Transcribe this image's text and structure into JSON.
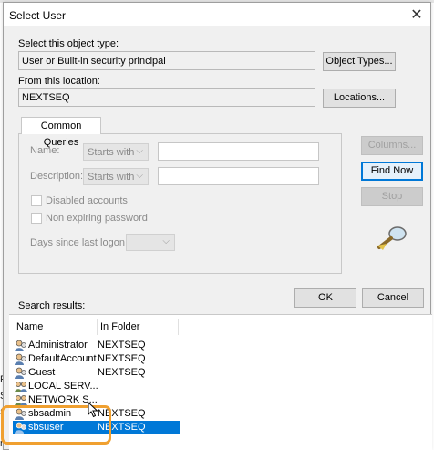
{
  "background": {
    "fragments": [
      "P.",
      "Se",
      "Se",
      "n"
    ]
  },
  "dialog": {
    "title": "Select User",
    "close_glyph": "✕",
    "object_type": {
      "label": "Select this object type:",
      "value": "User or Built-in security principal",
      "button": "Object Types..."
    },
    "location": {
      "label": "From this location:",
      "value": "NEXTSEQ",
      "button": "Locations..."
    },
    "common_queries": {
      "tab_label": "Common Queries",
      "name_label": "Name:",
      "name_mode": "Starts with",
      "description_label": "Description:",
      "description_mode": "Starts with",
      "disabled_accounts": "Disabled accounts",
      "non_expiring_password": "Non expiring password",
      "days_since_logon_label": "Days since last logon:"
    },
    "side_buttons": {
      "columns": "Columns...",
      "find_now": "Find Now",
      "stop": "Stop"
    },
    "ok": "OK",
    "cancel": "Cancel",
    "search_results_label": "Search results:",
    "results": {
      "columns": [
        "Name",
        "In Folder"
      ],
      "rows": [
        {
          "name": "Administrator",
          "folder": "NEXTSEQ",
          "icon": "user-icon"
        },
        {
          "name": "DefaultAccount",
          "folder": "NEXTSEQ",
          "icon": "user-icon"
        },
        {
          "name": "Guest",
          "folder": "NEXTSEQ",
          "icon": "user-icon"
        },
        {
          "name": "LOCAL SERV...",
          "folder": "",
          "icon": "group-icon"
        },
        {
          "name": "NETWORK S...",
          "folder": "",
          "icon": "group-icon"
        },
        {
          "name": "sbsadmin",
          "folder": "NEXTSEQ",
          "icon": "user-icon"
        },
        {
          "name": "sbsuser",
          "folder": "NEXTSEQ",
          "icon": "user-icon",
          "selected": true
        }
      ]
    }
  },
  "colors": {
    "selection": "#0078d7",
    "highlight": "#f0a030"
  }
}
